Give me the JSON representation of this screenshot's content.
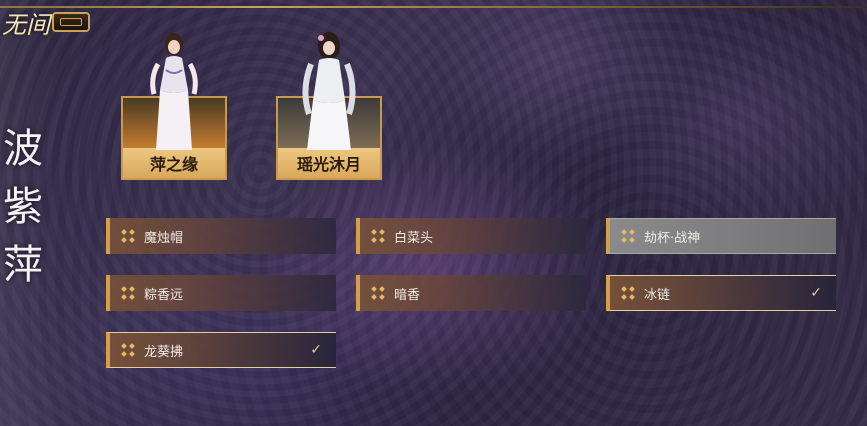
{
  "logo": {
    "text": "无间"
  },
  "side_calligraphy": [
    "波",
    "紫",
    "萍"
  ],
  "characters": [
    {
      "name": "萍之缘"
    },
    {
      "name": "瑶光沐月"
    }
  ],
  "options": [
    {
      "label": "魔烛帽",
      "selected": false
    },
    {
      "label": "白菜头",
      "selected": false
    },
    {
      "label": "劫杯·战神",
      "selected": false
    },
    {
      "label": "粽香远",
      "selected": false
    },
    {
      "label": "暗香",
      "selected": false
    },
    {
      "label": "冰链",
      "selected": true
    },
    {
      "label": "龙葵拂",
      "selected": true
    }
  ],
  "icons": {
    "option_icon": "four-diamond-icon",
    "check_icon": "checkmark-icon"
  },
  "colors": {
    "accent_gold": "#d2a04a",
    "name_bar": "#ecc882"
  }
}
